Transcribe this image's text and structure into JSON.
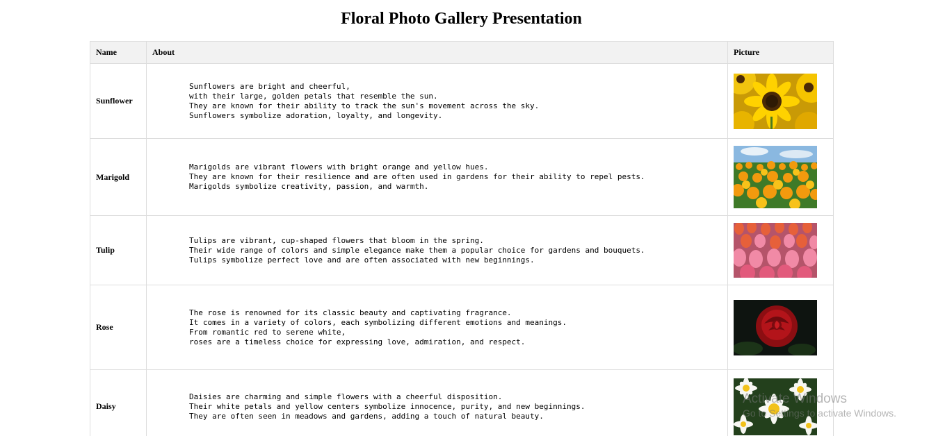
{
  "title": "Floral Photo Gallery Presentation",
  "table": {
    "headers": [
      "Name",
      "About",
      "Picture"
    ],
    "rows": [
      {
        "name": "Sunflower",
        "about": "        Sunflowers are bright and cheerful,\n        with their large, golden petals that resemble the sun.\n        They are known for their ability to track the sun's movement across the sky.\n        Sunflowers symbolize adoration, loyalty, and longevity.",
        "image_icon": "sunflower-photo"
      },
      {
        "name": "Marigold",
        "about": "        Marigolds are vibrant flowers with bright orange and yellow hues.\n        They are known for their resilience and are often used in gardens for their ability to repel pests.\n        Marigolds symbolize creativity, passion, and warmth.",
        "image_icon": "marigold-photo"
      },
      {
        "name": "Tulip",
        "about": "        Tulips are vibrant, cup-shaped flowers that bloom in the spring.\n        Their wide range of colors and simple elegance make them a popular choice for gardens and bouquets.\n        Tulips symbolize perfect love and are often associated with new beginnings.",
        "image_icon": "tulip-photo"
      },
      {
        "name": "Rose",
        "about": "        The rose is renowned for its classic beauty and captivating fragrance.\n        It comes in a variety of colors, each symbolizing different emotions and meanings.\n        From romantic red to serene white,\n        roses are a timeless choice for expressing love, admiration, and respect.",
        "image_icon": "rose-photo"
      },
      {
        "name": "Daisy",
        "about": "        Daisies are charming and simple flowers with a cheerful disposition.\n        Their white petals and yellow centers symbolize innocence, purity, and new beginnings.\n        They are often seen in meadows and gardens, adding a touch of natural beauty.",
        "image_icon": "daisy-photo"
      }
    ]
  },
  "watermark": {
    "title": "Activate Windows",
    "subtitle": "Go to Settings to activate Windows."
  }
}
